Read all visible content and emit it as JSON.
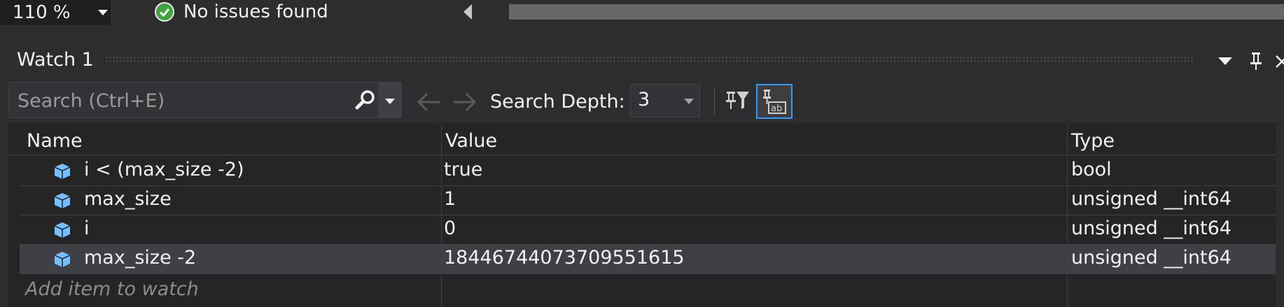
{
  "statusbar": {
    "zoom": "110 %",
    "issues": "No issues found"
  },
  "watch": {
    "title": "Watch 1",
    "search_placeholder": "Search (Ctrl+E)",
    "search_depth_label": "Search Depth:",
    "search_depth_value": "3",
    "columns": {
      "name": "Name",
      "value": "Value",
      "type": "Type"
    },
    "rows": [
      {
        "name": "i < (max_size -2)",
        "value": "true",
        "type": "bool"
      },
      {
        "name": "max_size",
        "value": "1",
        "type": "unsigned __int64"
      },
      {
        "name": "i",
        "value": "0",
        "type": "unsigned __int64"
      },
      {
        "name": "max_size -2",
        "value": "18446744073709551615",
        "type": "unsigned __int64"
      }
    ],
    "add_item_placeholder": "Add item to watch"
  },
  "icons": {
    "issues": "check-circle-icon",
    "variable": "cube-icon",
    "search": "search-icon",
    "filter": "pin-filter-icon",
    "view": "view-as-text-icon"
  },
  "colors": {
    "background": "#2d2d30",
    "grid": "#252526",
    "accent": "#3399ff",
    "ok": "#3fa33f",
    "variable_icon": "#75beff"
  }
}
